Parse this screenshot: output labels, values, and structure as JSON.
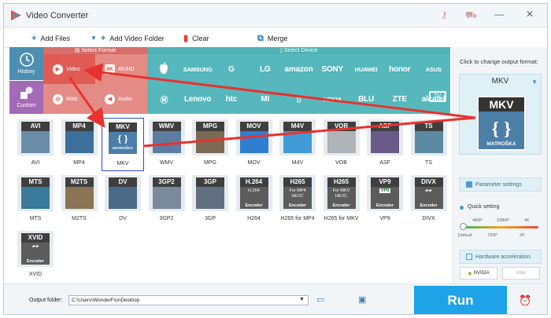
{
  "app": {
    "title": "Video Converter"
  },
  "toolbar": {
    "add_files": "Add Files",
    "add_video_folder": "Add Video Folder",
    "clear": "Clear",
    "merge": "Merge"
  },
  "sidebar": {
    "history": "History",
    "custom": "Custom"
  },
  "sections": {
    "select_format": "Select Format",
    "select_device": "Select Device"
  },
  "format_categories": {
    "video": "Video",
    "hd": "4K/HD",
    "web": "Web",
    "audio": "Audio"
  },
  "devices": {
    "row1": [
      "",
      "SAMSUNG",
      "G",
      "LG",
      "amazon",
      "SONY",
      "HUAWEI",
      "honor",
      "ASUS"
    ],
    "row2": [
      "",
      "Lenovo",
      "htc",
      "MI",
      "",
      "NOKIA",
      "BLU",
      "ZTE",
      "alcatel",
      "TV"
    ]
  },
  "formats": [
    {
      "tag": "AVI",
      "label": "AVI"
    },
    {
      "tag": "MP4",
      "label": "MP4"
    },
    {
      "tag": "MKV",
      "label": "MKV"
    },
    {
      "tag": "WMV",
      "label": "WMV"
    },
    {
      "tag": "MPG",
      "label": "MPG"
    },
    {
      "tag": "MOV",
      "label": "MOV"
    },
    {
      "tag": "M4V",
      "label": "M4V"
    },
    {
      "tag": "VOB",
      "label": "VOB"
    },
    {
      "tag": "ASF",
      "label": "ASF"
    },
    {
      "tag": "TS",
      "label": "TS"
    },
    {
      "tag": "MTS",
      "label": "MTS"
    },
    {
      "tag": "M2TS",
      "label": "M2TS"
    },
    {
      "tag": "DV",
      "label": "DV"
    },
    {
      "tag": "3GP2",
      "label": "3GP2"
    },
    {
      "tag": "3GP",
      "label": "3GP"
    },
    {
      "tag": "H.264",
      "label": "H264"
    },
    {
      "tag": "H265",
      "label": "H265 for MP4"
    },
    {
      "tag": "H265",
      "label": "H265 for MKV"
    },
    {
      "tag": "VP9",
      "label": "VP9"
    },
    {
      "tag": "DIVX",
      "label": "DIVX"
    },
    {
      "tag": "XVID",
      "label": "XVID"
    }
  ],
  "selected_format_index": 2,
  "tile_sub": {
    "matroska": "MATROŠKA",
    "encoder": "Encoder",
    "for_mp4": "For MP4",
    "for_mkv": "For MKV",
    "hevc": "HEVC",
    "h264": "H.264"
  },
  "right_panel": {
    "hint": "Click to change output format:",
    "output_format": "MKV",
    "output_badge": "MKV",
    "output_sub": "MATROŠKA",
    "parameter_settings": "Parameter settings",
    "quick_setting": "Quick setting",
    "ticks_top": [
      "480P",
      "1080P",
      "4K"
    ],
    "ticks_bottom": [
      "Default",
      "720P",
      "2K"
    ],
    "hardware_acceleration": "Hardware acceleration",
    "nvidia": "NVIDIA",
    "intel": "Intel"
  },
  "footer": {
    "output_folder_label": "Output folder:",
    "output_folder_value": "C:\\Users\\WonderFox\\Desktop",
    "run": "Run"
  },
  "colors": {
    "accent": "#1fa3e8",
    "annotation": "#e8322e",
    "format_red": "#e58b86",
    "device_teal": "#56b8bd"
  }
}
